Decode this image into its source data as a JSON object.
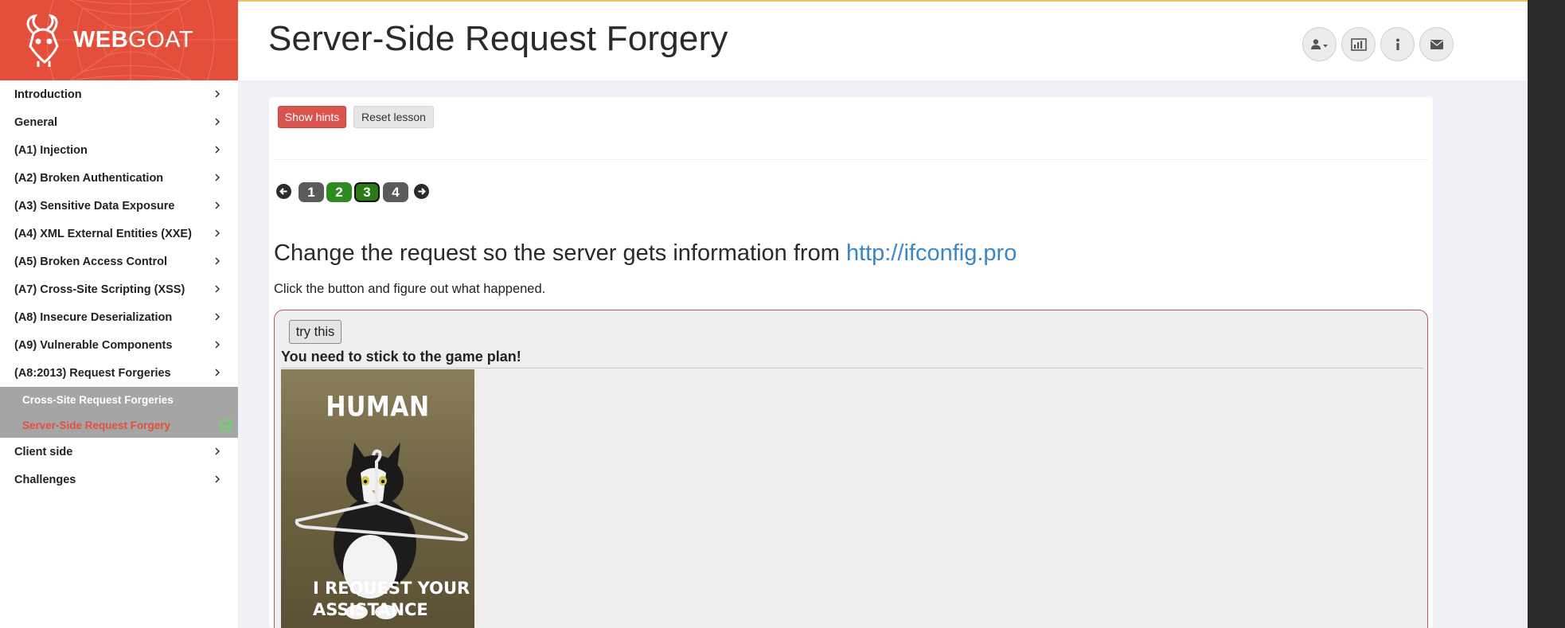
{
  "brand": {
    "bold": "WEB",
    "light": "GOAT"
  },
  "sidebar": {
    "items": [
      {
        "label": "Introduction"
      },
      {
        "label": "General"
      },
      {
        "label": "(A1) Injection"
      },
      {
        "label": "(A2) Broken Authentication"
      },
      {
        "label": "(A3) Sensitive Data Exposure"
      },
      {
        "label": "(A4) XML External Entities (XXE)"
      },
      {
        "label": "(A5) Broken Access Control"
      },
      {
        "label": "(A7) Cross-Site Scripting (XSS)"
      },
      {
        "label": "(A8) Insecure Deserialization"
      },
      {
        "label": "(A9) Vulnerable Components"
      },
      {
        "label": "(A8:2013) Request Forgeries"
      }
    ],
    "sub_items": [
      {
        "label": "Cross-Site Request Forgeries",
        "active": false
      },
      {
        "label": "Server-Side Request Forgery",
        "active": true,
        "completed": true
      }
    ],
    "items_after": [
      {
        "label": "Client side"
      },
      {
        "label": "Challenges"
      }
    ]
  },
  "header": {
    "title": "Server-Side Request Forgery",
    "buttons": [
      "user-icon",
      "chart-icon",
      "info-icon",
      "envelope-icon"
    ]
  },
  "toolbar": {
    "show_hints": "Show hints",
    "reset_lesson": "Reset lesson"
  },
  "pager": {
    "pages": [
      {
        "label": "1",
        "state": "gray"
      },
      {
        "label": "2",
        "state": "green"
      },
      {
        "label": "3",
        "state": "current"
      },
      {
        "label": "4",
        "state": "gray"
      }
    ]
  },
  "lesson": {
    "heading": "Change the request so the server gets information from ",
    "heading_link": "http://ifconfig.pro",
    "subtext": "Click the button and figure out what happened.",
    "try_button": "try this",
    "feedback": "You need to stick to the game plan!",
    "meme_top": "HUMAN",
    "meme_bottom_1": "I REQUEST YOUR",
    "meme_bottom_2": "ASSISTANCE"
  },
  "colors": {
    "brand": "#e44f3b",
    "hint_button": "#d9534f",
    "link": "#3a86c8",
    "page_done": "#2e8b1f",
    "page_todo": "#5a5a5a"
  }
}
